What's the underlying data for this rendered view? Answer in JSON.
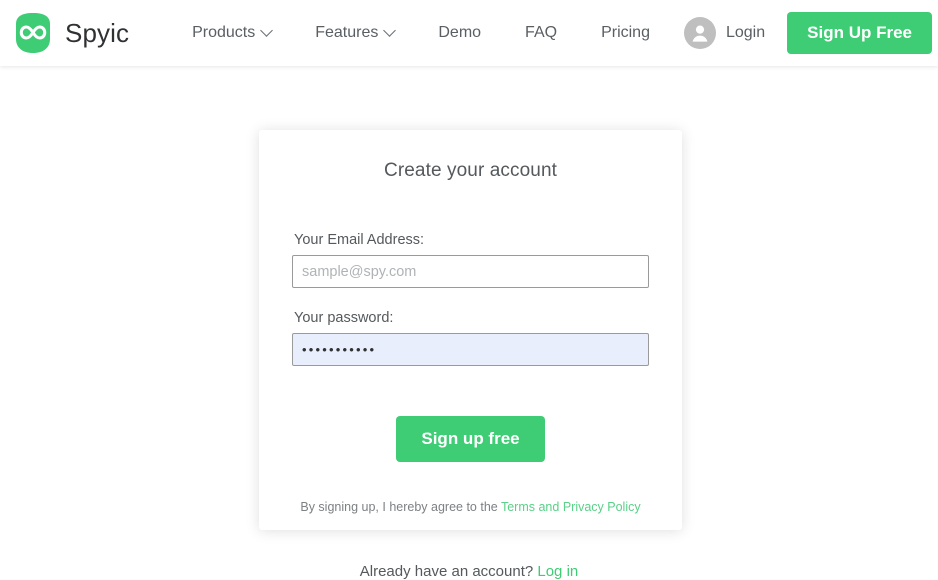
{
  "header": {
    "brand": {
      "name": "Spyic",
      "logo_icon": "infinity-shield-logo",
      "accent": "#3ecc74"
    },
    "nav_items": [
      {
        "label": "Products",
        "has_dropdown": true,
        "icon": "chevron-down-icon"
      },
      {
        "label": "Features",
        "has_dropdown": true,
        "icon": "chevron-down-icon"
      },
      {
        "label": "Demo",
        "has_dropdown": false
      },
      {
        "label": "FAQ",
        "has_dropdown": false
      },
      {
        "label": "Pricing",
        "has_dropdown": false
      }
    ],
    "login": {
      "label": "Login",
      "icon": "user-avatar-icon"
    },
    "signup_button": {
      "label": "Sign Up Free",
      "color": "#3ecc74"
    }
  },
  "signup_card": {
    "title": "Create your account",
    "email_field": {
      "label": "Your Email Address:",
      "placeholder": "sample@spy.com",
      "value": ""
    },
    "password_field": {
      "label": "Your password:",
      "placeholder": "",
      "value": "•••••••••••",
      "autofilled_background": "#e8eefb"
    },
    "submit_button": {
      "label": "Sign up free",
      "color": "#3ecc74"
    },
    "terms": {
      "prefix": "By signing up, I hereby agree to the ",
      "link_label": "Terms and Privacy Policy"
    }
  },
  "footer_prompt": {
    "text": "Already have an account? ",
    "link_label": "Log in"
  }
}
